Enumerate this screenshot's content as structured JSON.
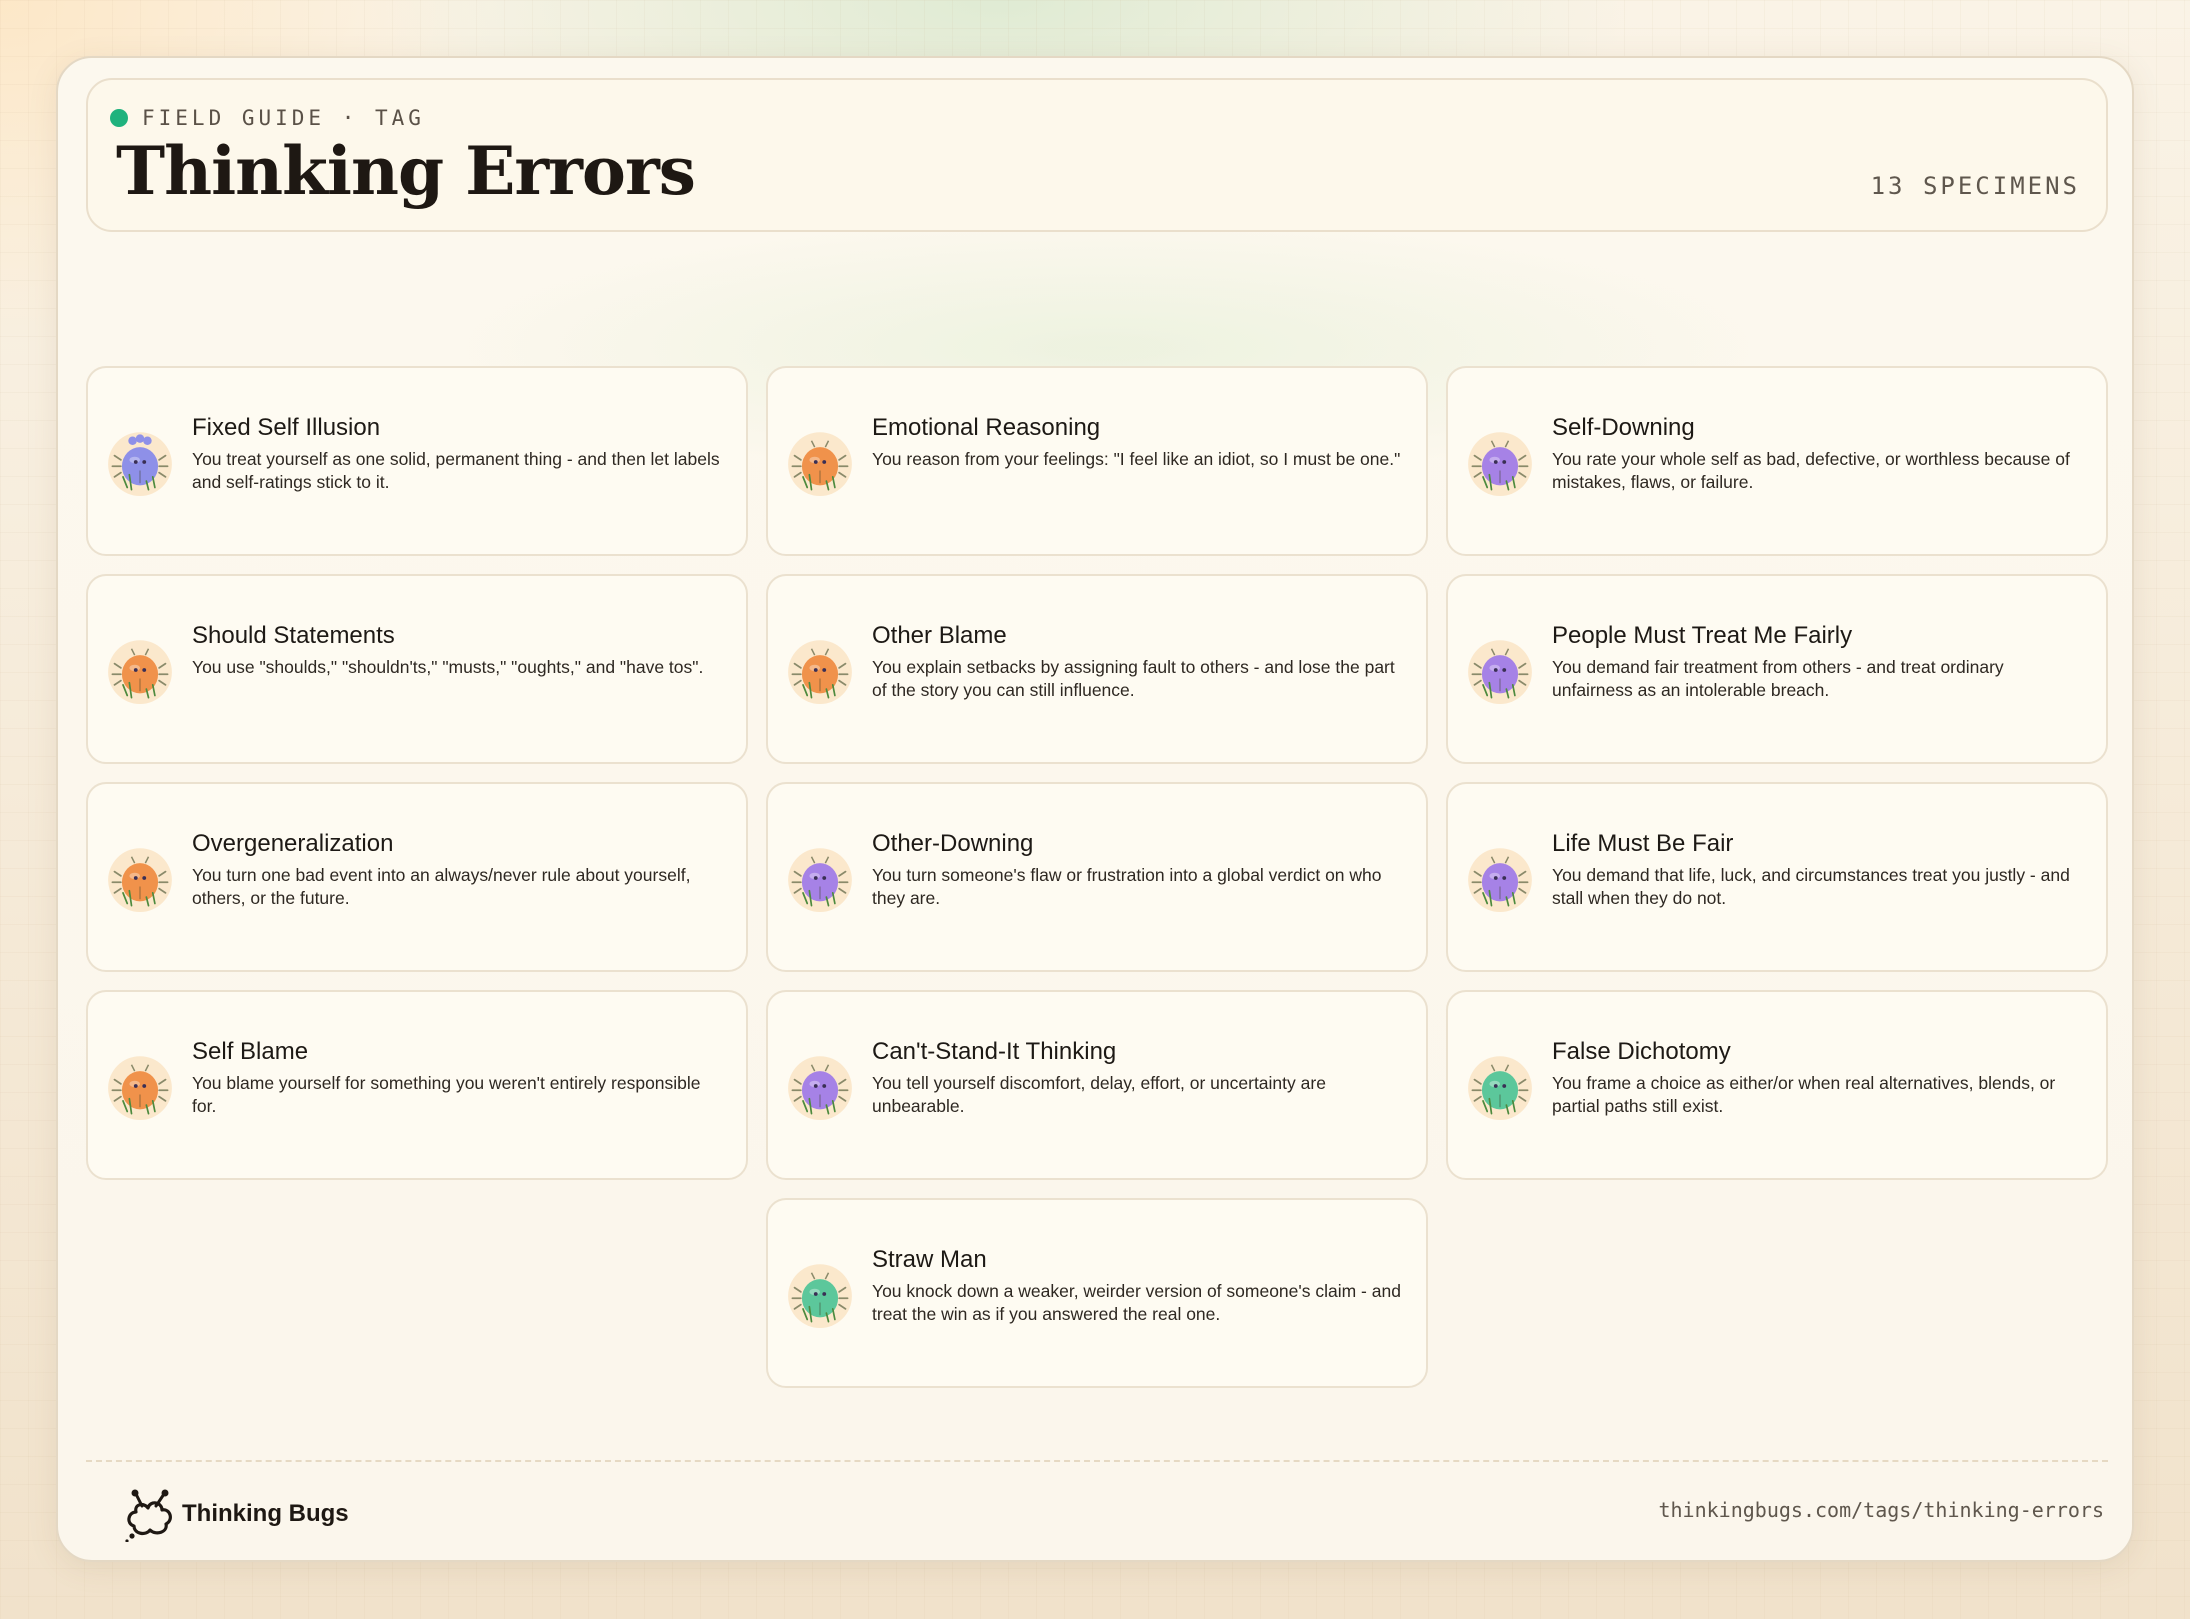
{
  "header": {
    "eyebrow": "FIELD GUIDE · TAG",
    "title": "Thinking Errors",
    "count": "13 SPECIMENS"
  },
  "colors": {
    "accent_dot": "#1fb27d",
    "bug_blue": "#8e90e8",
    "bug_orange": "#f0924b",
    "bug_purple": "#a682e6",
    "bug_green": "#5cc79b"
  },
  "cards": [
    {
      "title": "Fixed Self Illusion",
      "desc": "You treat yourself as one solid, permanent thing - and then let labels and self-ratings stick to it.",
      "color": "#8e90e8",
      "icon": "blue-antennae-bug-icon"
    },
    {
      "title": "Emotional Reasoning",
      "desc": "You reason from your feelings: \"I feel like an idiot, so I must be one.\"",
      "color": "#f0924b",
      "icon": "orange-bug-icon"
    },
    {
      "title": "Self-Downing",
      "desc": "You rate your whole self as bad, defective, or worthless because of mistakes, flaws, or failure.",
      "color": "#a682e6",
      "icon": "purple-bug-icon"
    },
    {
      "title": "Should Statements",
      "desc": "You use \"shoulds,\" \"shouldn'ts,\" \"musts,\" \"oughts,\" and \"have tos\".",
      "color": "#f0924b",
      "icon": "orange-bug-icon"
    },
    {
      "title": "Other Blame",
      "desc": "You explain setbacks by assigning fault to others - and lose the part of the story you can still influence.",
      "color": "#f0924b",
      "icon": "orange-bug-icon"
    },
    {
      "title": "People Must Treat Me Fairly",
      "desc": "You demand fair treatment from others - and treat ordinary unfairness as an intolerable breach.",
      "color": "#a682e6",
      "icon": "purple-bug-icon"
    },
    {
      "title": "Overgeneralization",
      "desc": "You turn one bad event into an always/never rule about yourself, others, or the future.",
      "color": "#f0924b",
      "icon": "orange-bug-icon"
    },
    {
      "title": "Other-Downing",
      "desc": "You turn someone's flaw or frustration into a global verdict on who they are.",
      "color": "#a682e6",
      "icon": "purple-bug-icon"
    },
    {
      "title": "Life Must Be Fair",
      "desc": "You demand that life, luck, and circumstances treat you justly - and stall when they do not.",
      "color": "#a682e6",
      "icon": "purple-bug-icon"
    },
    {
      "title": "Self Blame",
      "desc": "You blame yourself for something you weren't entirely responsible for.",
      "color": "#f0924b",
      "icon": "orange-bug-icon"
    },
    {
      "title": "Can't-Stand-It Thinking",
      "desc": "You tell yourself discomfort, delay, effort, or uncertainty are unbearable.",
      "color": "#a682e6",
      "icon": "purple-bug-icon"
    },
    {
      "title": "False Dichotomy",
      "desc": "You frame a choice as either/or when real alternatives, blends, or partial paths still exist.",
      "color": "#5cc79b",
      "icon": "green-bug-icon"
    },
    {
      "title": "Straw Man",
      "desc": "You knock down a weaker, weirder version of someone's claim - and treat the win as if you answered the real one.",
      "color": "#5cc79b",
      "icon": "green-bug-icon"
    }
  ],
  "footer": {
    "brand": "Thinking Bugs",
    "url": "thinkingbugs.com/tags/thinking-errors"
  }
}
